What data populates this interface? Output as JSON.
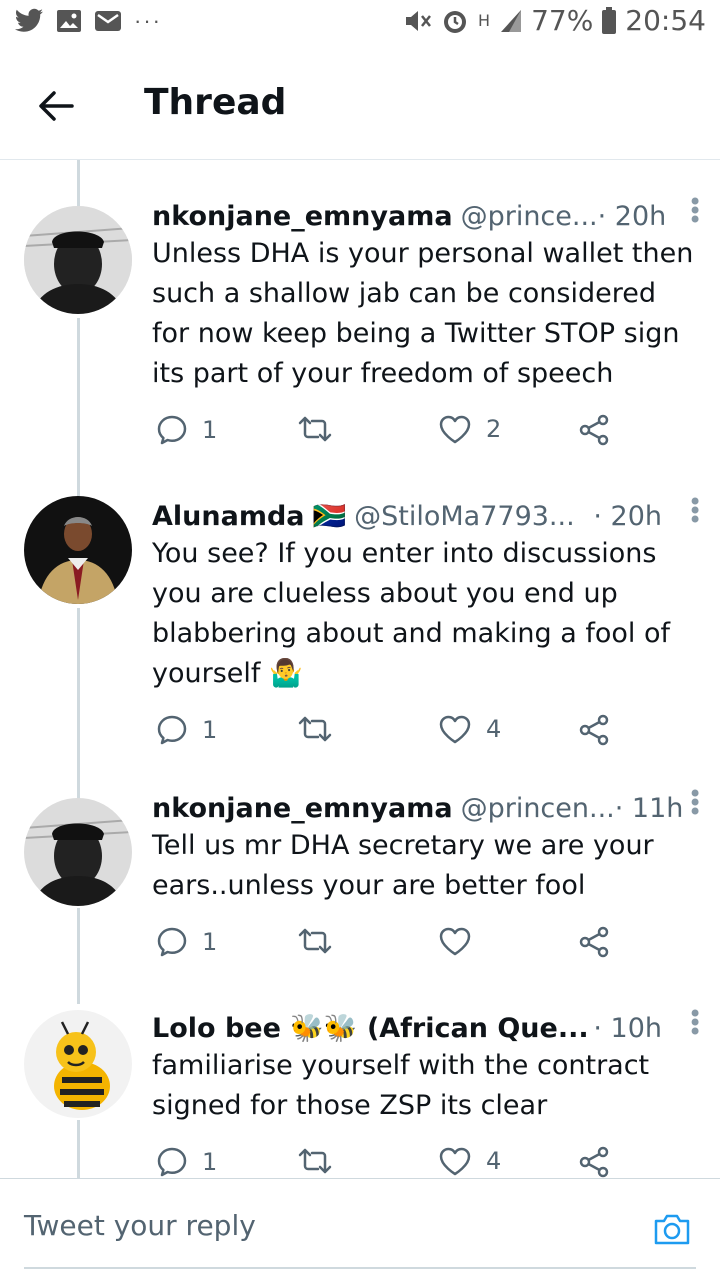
{
  "status_bar": {
    "battery": "77%",
    "time": "20:54",
    "network": "H",
    "overflow": "···"
  },
  "header": {
    "title": "Thread"
  },
  "tweets": [
    {
      "name": "nkonjane_emnyama",
      "handle": "@prince...",
      "time": "· 20h",
      "text": "Unless DHA is your personal wallet then such a shallow jab can be considered for now keep being a Twitter STOP sign its part of your freedom of speech",
      "replies": "1",
      "retweets": "",
      "likes": "2"
    },
    {
      "name": "Alunamda",
      "flag": "🇿🇦",
      "handle": "@StiloMa7793...",
      "time": "· 20h",
      "text": "You see? If you enter into discussions you are clueless about you end up blabbering about and making a fool of yourself 🤷‍♂️",
      "replies": "1",
      "retweets": "",
      "likes": "4"
    },
    {
      "name": "nkonjane_emnyama",
      "handle": "@princen...",
      "time": "· 11h",
      "text": "Tell us mr DHA secretary we are your ears..unless your are better fool",
      "replies": "1",
      "retweets": "",
      "likes": ""
    },
    {
      "name": "Lolo bee 🐝🐝 (African Que...",
      "handle": "",
      "time": "· 10h",
      "text": "familiarise yourself with the contract signed for those ZSP its clear",
      "replies": "1",
      "retweets": "",
      "likes": "4"
    }
  ],
  "reply_bar": {
    "placeholder": "Tweet your reply"
  },
  "colors": {
    "accent": "#1d9bf0",
    "text": "#0f1419",
    "secondary": "#536471",
    "divider": "#cfd9de"
  }
}
